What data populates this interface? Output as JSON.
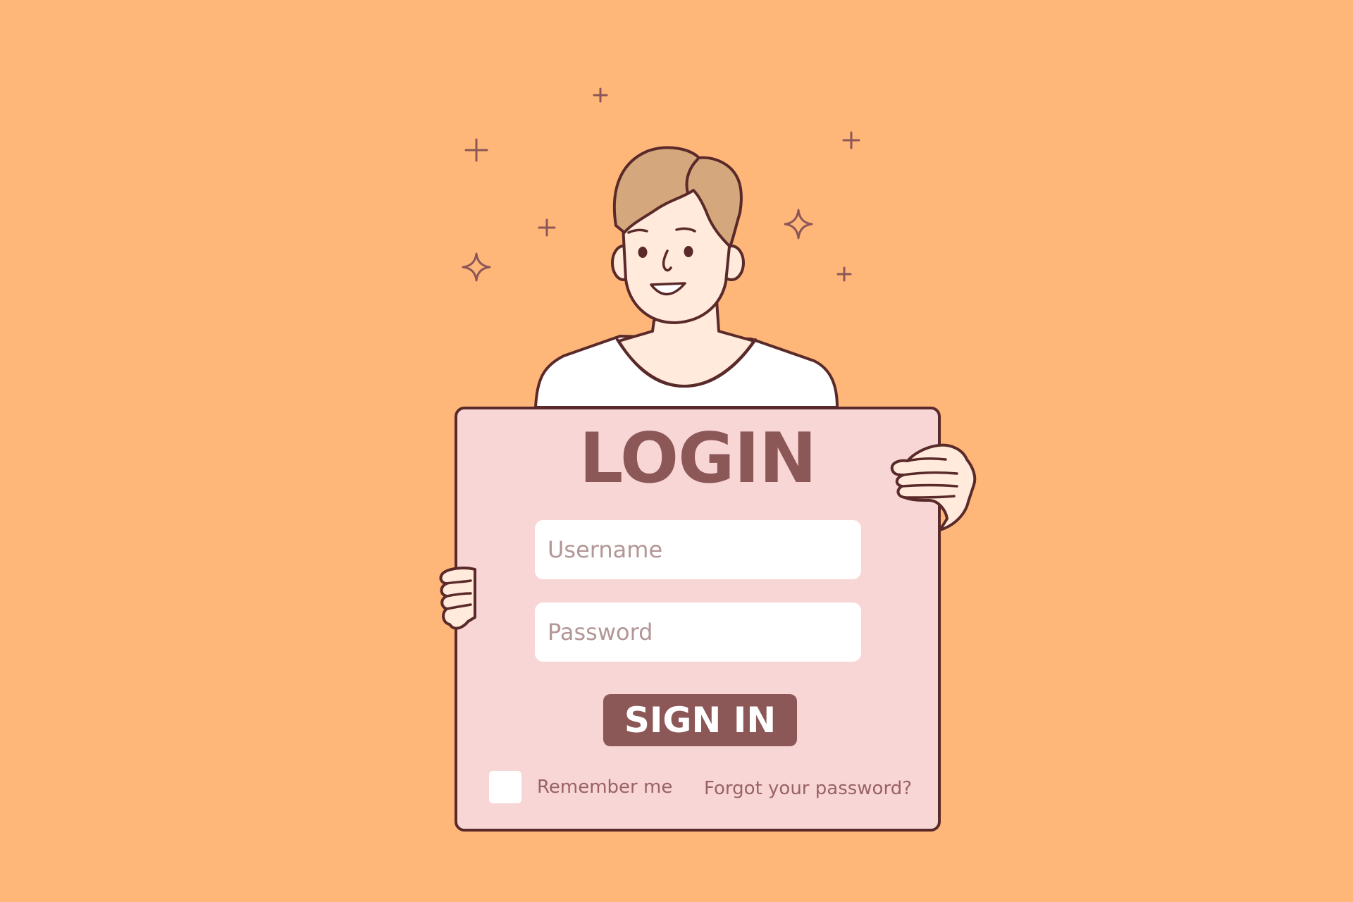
{
  "colors": {
    "background": "#FFB679",
    "card_fill": "#F8D6D6",
    "outline": "#5A2A2A",
    "accent": "#8C5757",
    "muted_text": "#9A6363",
    "placeholder": "#B39696",
    "skin": "#FFEADB",
    "hair": "#D4A77C",
    "shirt": "#FFFFFF"
  },
  "illustration": {
    "subject": "person-holding-login-card",
    "sparkle_icon": "sparkle-icon"
  },
  "login_card": {
    "title": "LOGIN",
    "username": {
      "placeholder": "Username",
      "value": ""
    },
    "password": {
      "placeholder": "Password",
      "value": ""
    },
    "sign_in_label": "SIGN IN",
    "remember_me": {
      "label": "Remember me",
      "checked": false
    },
    "forgot_password_label": "Forgot your password?"
  }
}
